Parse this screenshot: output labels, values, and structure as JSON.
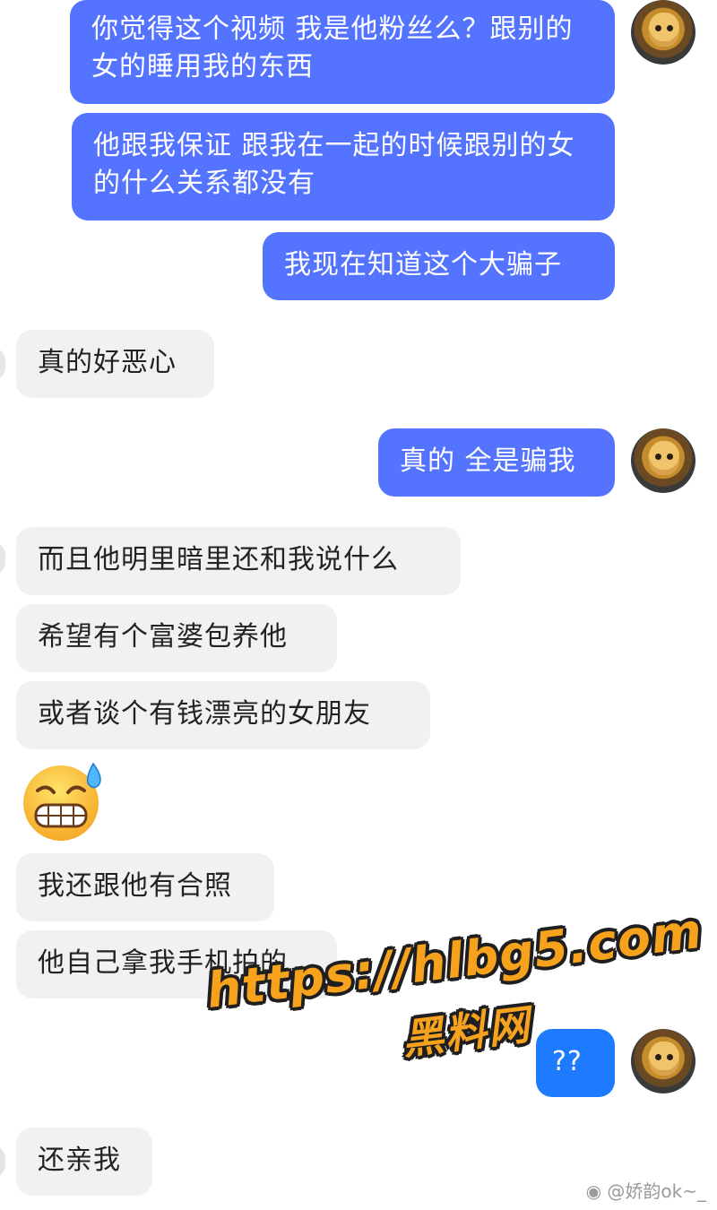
{
  "messages": [
    {
      "side": "sent",
      "text": "你觉得这个视频 我是他粉丝么？跟别的女的睡用我的东西"
    },
    {
      "side": "sent",
      "text": "他跟我保证 跟我在一起的时候跟别的女的什么关系都没有"
    },
    {
      "side": "sent",
      "text": "我现在知道这个大骗子"
    },
    {
      "side": "received",
      "text": "真的好恶心"
    },
    {
      "side": "sent",
      "text": "真的 全是骗我"
    },
    {
      "side": "received",
      "text": "而且他明里暗里还和我说什么"
    },
    {
      "side": "received",
      "text": "希望有个富婆包养他"
    },
    {
      "side": "received",
      "text": "或者谈个有钱漂亮的女朋友"
    },
    {
      "side": "received",
      "emoji": "grimacing-sweat-emoji"
    },
    {
      "side": "received",
      "text": "我还跟他有合照"
    },
    {
      "side": "received",
      "text": "他自己拿我手机拍的"
    },
    {
      "side": "sent",
      "text": "??"
    },
    {
      "side": "received",
      "text": "还亲我"
    }
  ],
  "watermark": {
    "url": "https://hlbg5.com",
    "name": "黑料网"
  },
  "footer": {
    "credit": "@娇韵ok~_"
  },
  "colors": {
    "sent_bubble": "#5473ff",
    "received_bubble": "#f1f1f3",
    "watermark": "#f7a21c"
  }
}
